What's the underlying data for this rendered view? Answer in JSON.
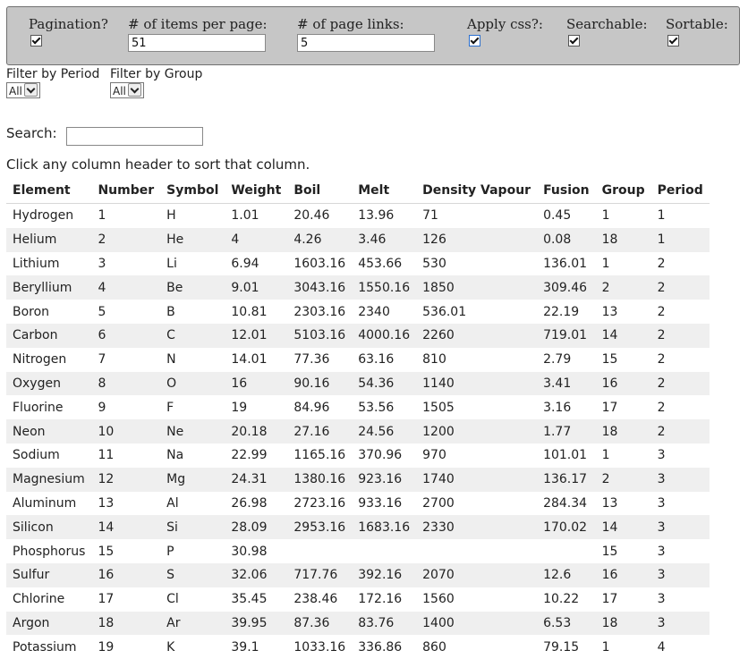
{
  "settings": {
    "pagination": {
      "label": "Pagination?",
      "checked": true
    },
    "items_per_page": {
      "label": "# of items per page:",
      "value": "51"
    },
    "page_links": {
      "label": "# of page links:",
      "value": "5"
    },
    "apply_css": {
      "label": "Apply css?:",
      "checked": true
    },
    "searchable": {
      "label": "Searchable:",
      "checked": true
    },
    "sortable": {
      "label": "Sortable:",
      "checked": true
    }
  },
  "filters": {
    "period": {
      "label": "Filter by Period",
      "selected": "All"
    },
    "group": {
      "label": "Filter by Group",
      "selected": "All"
    }
  },
  "search": {
    "label": "Search:",
    "value": ""
  },
  "hint": "Click any column header to sort that column.",
  "table": {
    "columns": [
      "Element",
      "Number",
      "Symbol",
      "Weight",
      "Boil",
      "Melt",
      "Density Vapour",
      "Fusion",
      "Group",
      "Period"
    ],
    "rows": [
      [
        "Hydrogen",
        "1",
        "H",
        "1.01",
        "20.46",
        "13.96",
        "71",
        "0.45",
        "1",
        "1"
      ],
      [
        "Helium",
        "2",
        "He",
        "4",
        "4.26",
        "3.46",
        "126",
        "0.08",
        "18",
        "1"
      ],
      [
        "Lithium",
        "3",
        "Li",
        "6.94",
        "1603.16",
        "453.66",
        "530",
        "136.01",
        "1",
        "2"
      ],
      [
        "Beryllium",
        "4",
        "Be",
        "9.01",
        "3043.16",
        "1550.16",
        "1850",
        "309.46",
        "2",
        "2"
      ],
      [
        "Boron",
        "5",
        "B",
        "10.81",
        "2303.16",
        "2340",
        "536.01",
        "22.19",
        "13",
        "2"
      ],
      [
        "Carbon",
        "6",
        "C",
        "12.01",
        "5103.16",
        "4000.16",
        "2260",
        "719.01",
        "14",
        "2"
      ],
      [
        "Nitrogen",
        "7",
        "N",
        "14.01",
        "77.36",
        "63.16",
        "810",
        "2.79",
        "15",
        "2"
      ],
      [
        "Oxygen",
        "8",
        "O",
        "16",
        "90.16",
        "54.36",
        "1140",
        "3.41",
        "16",
        "2"
      ],
      [
        "Fluorine",
        "9",
        "F",
        "19",
        "84.96",
        "53.56",
        "1505",
        "3.16",
        "17",
        "2"
      ],
      [
        "Neon",
        "10",
        "Ne",
        "20.18",
        "27.16",
        "24.56",
        "1200",
        "1.77",
        "18",
        "2"
      ],
      [
        "Sodium",
        "11",
        "Na",
        "22.99",
        "1165.16",
        "370.96",
        "970",
        "101.01",
        "1",
        "3"
      ],
      [
        "Magnesium",
        "12",
        "Mg",
        "24.31",
        "1380.16",
        "923.16",
        "1740",
        "136.17",
        "2",
        "3"
      ],
      [
        "Aluminum",
        "13",
        "Al",
        "26.98",
        "2723.16",
        "933.16",
        "2700",
        "284.34",
        "13",
        "3"
      ],
      [
        "Silicon",
        "14",
        "Si",
        "28.09",
        "2953.16",
        "1683.16",
        "2330",
        "170.02",
        "14",
        "3"
      ],
      [
        "Phosphorus",
        "15",
        "P",
        "30.98",
        "",
        "",
        "",
        "",
        "15",
        "3"
      ],
      [
        "Sulfur",
        "16",
        "S",
        "32.06",
        "717.76",
        "392.16",
        "2070",
        "12.6",
        "16",
        "3"
      ],
      [
        "Chlorine",
        "17",
        "Cl",
        "35.45",
        "238.46",
        "172.16",
        "1560",
        "10.22",
        "17",
        "3"
      ],
      [
        "Argon",
        "18",
        "Ar",
        "39.95",
        "87.36",
        "83.76",
        "1400",
        "6.53",
        "18",
        "3"
      ],
      [
        "Potassium",
        "19",
        "K",
        "39.1",
        "1033.16",
        "336.86",
        "860",
        "79.15",
        "1",
        "4"
      ]
    ]
  }
}
